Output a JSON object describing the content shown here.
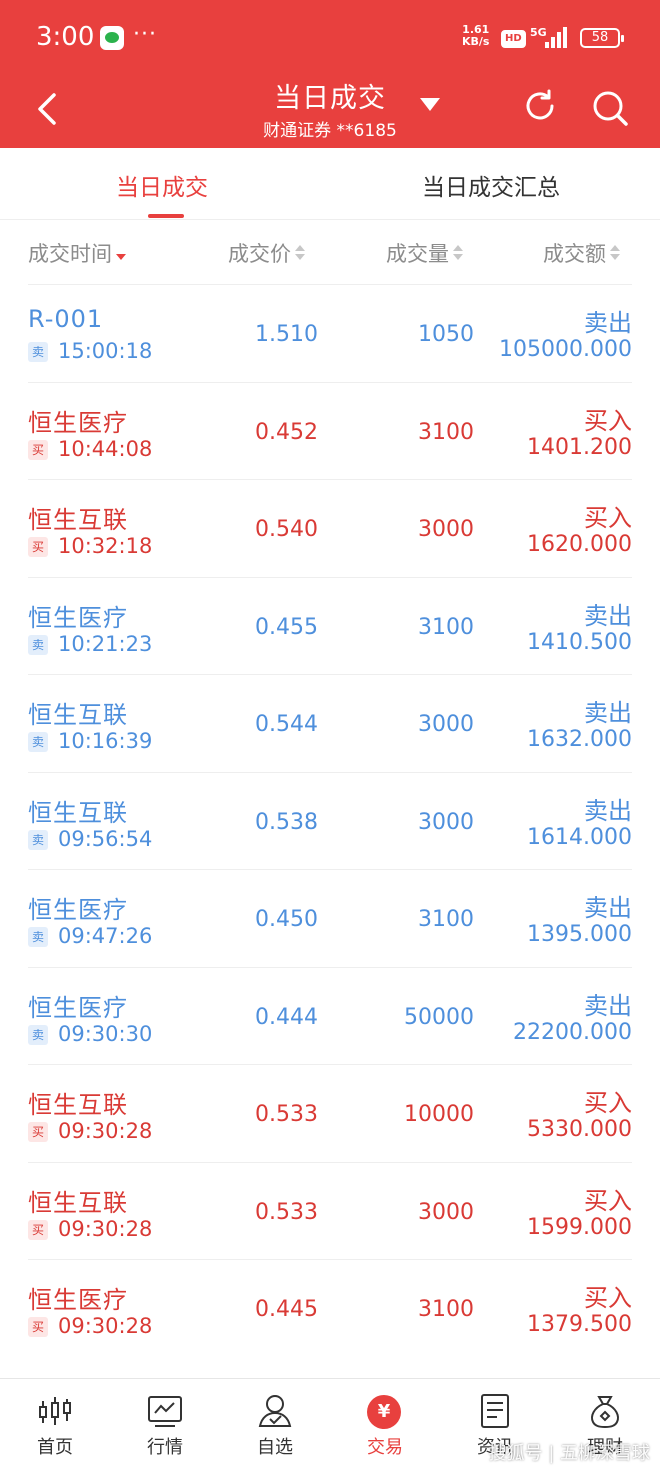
{
  "status_bar": {
    "time": "3:00",
    "dots": "···",
    "net_speed": "1.61",
    "net_unit": "KB/s",
    "hd": "HD",
    "signal": "5G",
    "battery": "58"
  },
  "header": {
    "title": "当日成交",
    "subtitle": "财通证券 **6185"
  },
  "tabs": [
    {
      "label": "当日成交",
      "active": true
    },
    {
      "label": "当日成交汇总",
      "active": false
    }
  ],
  "columns": [
    "成交时间",
    "成交价",
    "成交量",
    "成交额"
  ],
  "rows": [
    {
      "name": "R-001",
      "side": "卖",
      "time": "15:00:18",
      "price": "1.510",
      "qty": "1050",
      "dir": "卖出",
      "amount": "105000.000",
      "type": "sell"
    },
    {
      "name": "恒生医疗",
      "side": "买",
      "time": "10:44:08",
      "price": "0.452",
      "qty": "3100",
      "dir": "买入",
      "amount": "1401.200",
      "type": "buy"
    },
    {
      "name": "恒生互联",
      "side": "买",
      "time": "10:32:18",
      "price": "0.540",
      "qty": "3000",
      "dir": "买入",
      "amount": "1620.000",
      "type": "buy"
    },
    {
      "name": "恒生医疗",
      "side": "卖",
      "time": "10:21:23",
      "price": "0.455",
      "qty": "3100",
      "dir": "卖出",
      "amount": "1410.500",
      "type": "sell"
    },
    {
      "name": "恒生互联",
      "side": "卖",
      "time": "10:16:39",
      "price": "0.544",
      "qty": "3000",
      "dir": "卖出",
      "amount": "1632.000",
      "type": "sell"
    },
    {
      "name": "恒生互联",
      "side": "卖",
      "time": "09:56:54",
      "price": "0.538",
      "qty": "3000",
      "dir": "卖出",
      "amount": "1614.000",
      "type": "sell"
    },
    {
      "name": "恒生医疗",
      "side": "卖",
      "time": "09:47:26",
      "price": "0.450",
      "qty": "3100",
      "dir": "卖出",
      "amount": "1395.000",
      "type": "sell"
    },
    {
      "name": "恒生医疗",
      "side": "卖",
      "time": "09:30:30",
      "price": "0.444",
      "qty": "50000",
      "dir": "卖出",
      "amount": "22200.000",
      "type": "sell"
    },
    {
      "name": "恒生互联",
      "side": "买",
      "time": "09:30:28",
      "price": "0.533",
      "qty": "10000",
      "dir": "买入",
      "amount": "5330.000",
      "type": "buy"
    },
    {
      "name": "恒生互联",
      "side": "买",
      "time": "09:30:28",
      "price": "0.533",
      "qty": "3000",
      "dir": "买入",
      "amount": "1599.000",
      "type": "buy"
    },
    {
      "name": "恒生医疗",
      "side": "买",
      "time": "09:30:28",
      "price": "0.445",
      "qty": "3100",
      "dir": "买入",
      "amount": "1379.500",
      "type": "buy"
    }
  ],
  "bottom_nav": [
    {
      "label": "首页",
      "icon": "candlestick-icon"
    },
    {
      "label": "行情",
      "icon": "chart-icon"
    },
    {
      "label": "自选",
      "icon": "user-icon"
    },
    {
      "label": "交易",
      "icon": "yen-icon",
      "symbol": "¥",
      "active": true
    },
    {
      "label": "资讯",
      "icon": "document-icon"
    },
    {
      "label": "理财",
      "icon": "money-bag-icon"
    }
  ],
  "watermark": "搜狐号 | 五柳深雪球",
  "colors": {
    "brand": "#e8403e",
    "sell": "#4e8fdc",
    "buy": "#d93a35"
  }
}
